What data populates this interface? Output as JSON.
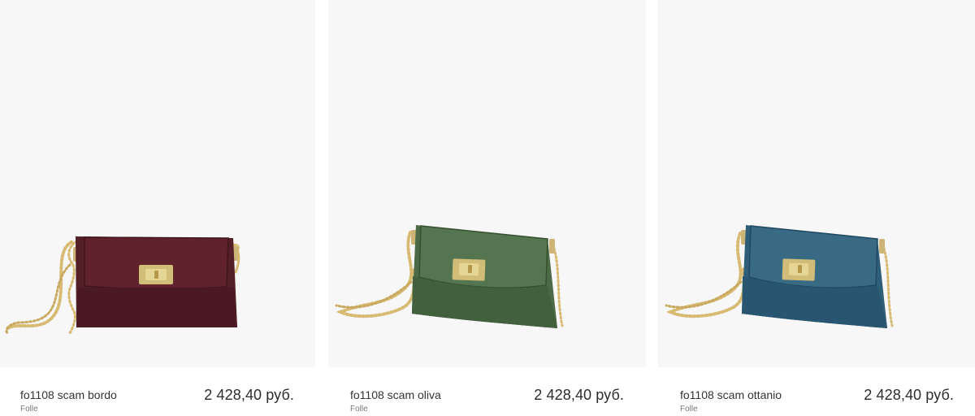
{
  "products": [
    {
      "title": "fo1108 scam bordo",
      "brand": "Folle",
      "price": "2 428,40 руб.",
      "image_name": "burgundy-suede-crossbody-bag",
      "bag_color": "#532028",
      "bag_shadow_color": "#3f151c"
    },
    {
      "title": "fo1108 scam oliva",
      "brand": "Folle",
      "price": "2 428,40 руб.",
      "image_name": "olive-suede-crossbody-bag",
      "bag_color": "#4b6a45",
      "bag_shadow_color": "#36502f"
    },
    {
      "title": "fo1108 scam ottanio",
      "brand": "Folle",
      "price": "2 428,40 руб.",
      "image_name": "teal-suede-crossbody-bag",
      "bag_color": "#2f5f78",
      "bag_shadow_color": "#204960"
    }
  ],
  "colors": {
    "image_background": "#f7f7f7",
    "chain_gold": "#d8bb72",
    "clasp_gold": "#d1bd78"
  }
}
